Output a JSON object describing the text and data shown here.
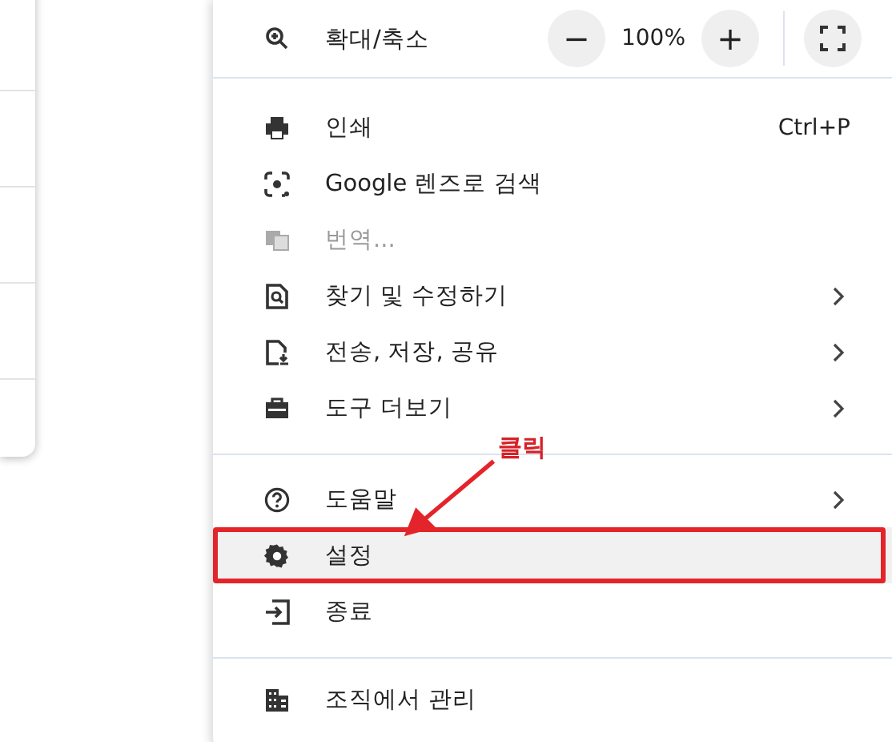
{
  "zoom": {
    "label": "확대/축소",
    "decrease": "−",
    "value": "100%",
    "increase": "+"
  },
  "groups": [
    {
      "items": [
        {
          "kind": "print",
          "label": "인쇄",
          "shortcut": "Ctrl+P",
          "submenu": false,
          "disabled": false,
          "selected": false
        },
        {
          "kind": "lens",
          "label": "Google 렌즈로 검색",
          "submenu": false,
          "disabled": false,
          "selected": false
        },
        {
          "kind": "translate",
          "label": "번역...",
          "submenu": false,
          "disabled": true,
          "selected": false
        },
        {
          "kind": "find",
          "label": "찾기 및 수정하기",
          "submenu": true,
          "disabled": false,
          "selected": false
        },
        {
          "kind": "save",
          "label": "전송, 저장, 공유",
          "submenu": true,
          "disabled": false,
          "selected": false
        },
        {
          "kind": "toolbox",
          "label": "도구 더보기",
          "submenu": true,
          "disabled": false,
          "selected": false
        }
      ]
    },
    {
      "items": [
        {
          "kind": "help",
          "label": "도움말",
          "submenu": true,
          "disabled": false,
          "selected": false
        },
        {
          "kind": "gear",
          "label": "설정",
          "submenu": false,
          "disabled": false,
          "selected": true
        },
        {
          "kind": "exit",
          "label": "종료",
          "submenu": false,
          "disabled": false,
          "selected": false
        }
      ]
    },
    {
      "items": [
        {
          "kind": "building",
          "label": "조직에서 관리",
          "submenu": false,
          "disabled": false,
          "selected": false
        }
      ]
    }
  ],
  "annotation": {
    "label": "클릭"
  }
}
